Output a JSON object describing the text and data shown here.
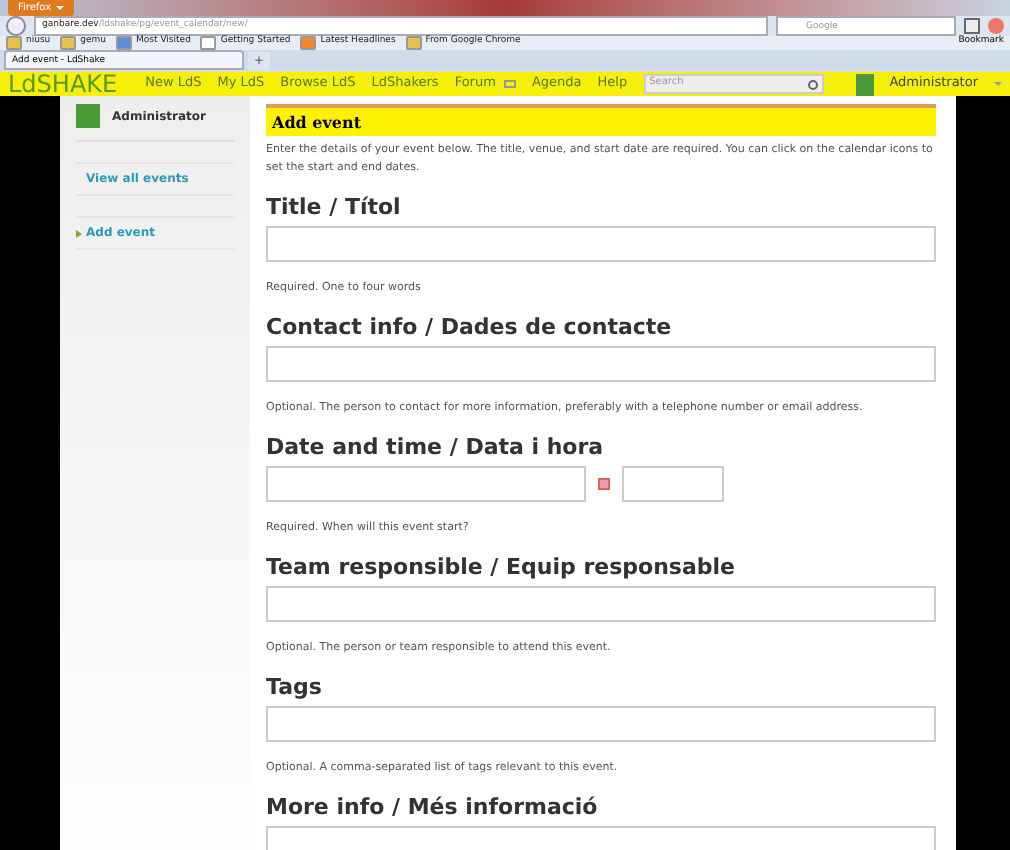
{
  "browser": {
    "menu_button": "Firefox",
    "url_host": "ganbare.dev",
    "url_path": "/ldshake/pg/event_calendar/new/",
    "search_engine": "Google",
    "bookmarks": [
      {
        "label": "niusu",
        "kind": "folder"
      },
      {
        "label": "gemu",
        "kind": "folder"
      },
      {
        "label": "Most Visited",
        "kind": "special"
      },
      {
        "label": "Getting Started",
        "kind": "page"
      },
      {
        "label": "Latest Headlines",
        "kind": "feed"
      },
      {
        "label": "From Google Chrome",
        "kind": "folder"
      }
    ],
    "bookmarks_menu": "Bookmark",
    "tabs": [
      {
        "label": "Add event - LdShake",
        "selected": true
      }
    ],
    "new_tab": "+"
  },
  "site": {
    "logo": "LdSHAKE",
    "nav": [
      "New LdS",
      "My LdS",
      "Browse LdS",
      "LdShakers",
      "Forum",
      "Agenda",
      "Help"
    ],
    "search": {
      "placeholder": "Search"
    },
    "user": "Administrator"
  },
  "sidebar": {
    "user": "Administrator",
    "items": [
      {
        "label": "View all events",
        "selected": false
      },
      {
        "label": "Add event",
        "selected": true
      }
    ]
  },
  "form": {
    "title": "Add event",
    "intro": "Enter the details of your event below. The title, venue, and start date are required. You can click on the calendar icons to set the start and end dates.",
    "fields": [
      {
        "label": "Title / Títol",
        "kind": "text",
        "hint": "Required. One to four words"
      },
      {
        "label": "Contact info / Dades de contacte",
        "kind": "text",
        "hint": "Optional. The person to contact for more information, preferably with a telephone number or email address."
      },
      {
        "label": "Date and time / Data i hora",
        "kind": "date",
        "hint": "Required. When will this event start?"
      },
      {
        "label": "Team responsible / Equip responsable",
        "kind": "text",
        "hint": "Optional. The person or team responsible to attend this event."
      },
      {
        "label": "Tags",
        "kind": "text",
        "hint": "Optional. A comma-separated list of tags relevant to this event."
      },
      {
        "label": "More info / Més informació",
        "kind": "textarea"
      }
    ]
  }
}
